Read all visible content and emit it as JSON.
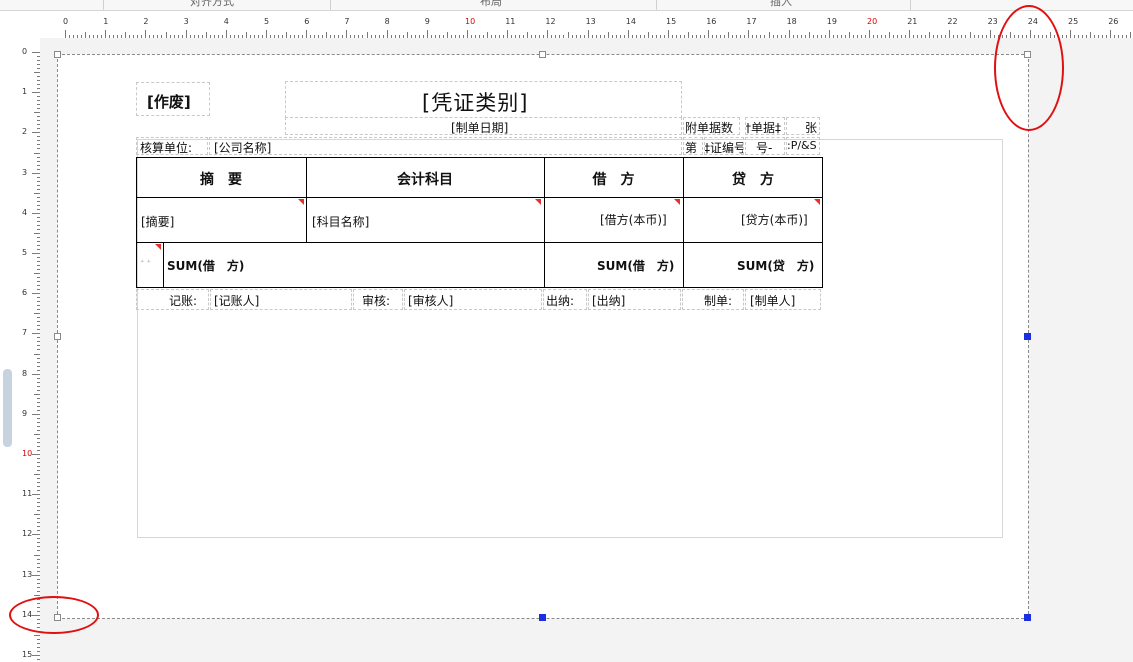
{
  "toolbar_tabs": [
    "对齐方式",
    "布局",
    "插入"
  ],
  "ruler": {
    "horizontal": [
      "0",
      "1",
      "2",
      "3",
      "4",
      "5",
      "6",
      "7",
      "8",
      "9",
      "10",
      "11",
      "12",
      "13",
      "14",
      "15",
      "16",
      "17",
      "18",
      "19",
      "20",
      "21",
      "22",
      "23",
      "24",
      "25",
      "26"
    ],
    "vertical": [
      "0",
      "1",
      "2",
      "3",
      "4",
      "5",
      "6",
      "7",
      "8",
      "9",
      "10",
      "11",
      "12",
      "13",
      "14",
      "15"
    ],
    "highlight": [
      "10",
      "20"
    ],
    "highlight_color": "#e00000"
  },
  "report": {
    "void_label": "[作废]",
    "title": "[凭证类别]",
    "date": "[制单日期]",
    "attach_label": "附单据数",
    "attach_value": "†单据‡",
    "attach_unit": "张",
    "company_label": "核算单位:",
    "company_value": "[公司名称]",
    "page_label": "第",
    "voucher_no": "‡证编号",
    "number": "号-",
    "page_expr": ":P/&S",
    "columns": [
      "摘　要",
      "会计科目",
      "借　方",
      "贷　方"
    ],
    "row": {
      "summary": "[摘要]",
      "account": "[科目名称]",
      "debit": "[借方(本币)]",
      "credit": "[贷方(本币)]"
    },
    "total": {
      "icon_text": "⁺ ⁺",
      "debit_left": "SUM(借　方)",
      "debit": "SUM(借　方)",
      "credit": "SUM(贷　方)"
    },
    "footer": {
      "bookkeeper_label": "记账:",
      "bookkeeper": "[记账人]",
      "reviewer_label": "审核:",
      "reviewer": "[审核人]",
      "cashier_label": "出纳:",
      "cashier": "[出纳]",
      "maker_label": "制单:",
      "maker": "[制单人]"
    }
  },
  "colors": {
    "annotation": "#e01010",
    "selection_handle": "#1a30e0",
    "cell_marker": "#e53030"
  }
}
